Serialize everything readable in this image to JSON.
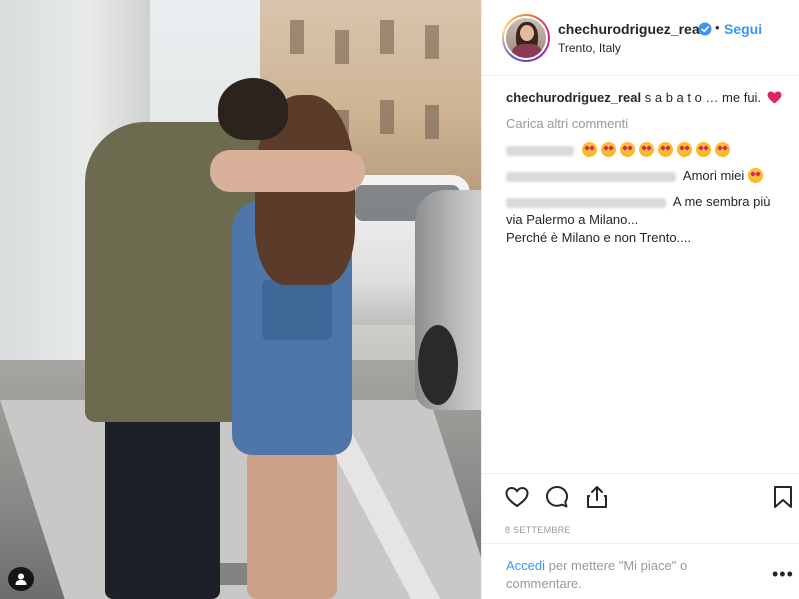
{
  "post": {
    "username": "chechurodriguez_real",
    "verified": true,
    "separator": "•",
    "follow_label": "Segui",
    "location": "Trento, Italy"
  },
  "caption": {
    "username": "chechurodriguez_real",
    "text": "s a b a t o … me fui."
  },
  "load_more_label": "Carica altri commenti",
  "comments": [
    {
      "user": "",
      "text": "",
      "emoji_count": 8
    },
    {
      "user": "",
      "text": "Amori miei"
    },
    {
      "user": "",
      "lines": [
        "A me sembra più",
        "via Palermo a Milano...",
        "Perché è Milano e non Trento...."
      ]
    }
  ],
  "date_label": "8 SETTEMBRE",
  "login": {
    "link": "Accedi",
    "text": "per mettere \"Mi piace\" o commentare."
  },
  "more_label": "•••",
  "colors": {
    "link_blue": "#3897f0",
    "heart_red": "#ed4956",
    "text": "#262626",
    "muted": "#999999"
  },
  "icons": [
    "user-tag-icon",
    "verified-badge-icon",
    "heart-icon",
    "comment-icon",
    "share-icon",
    "bookmark-icon",
    "more-options-icon"
  ]
}
